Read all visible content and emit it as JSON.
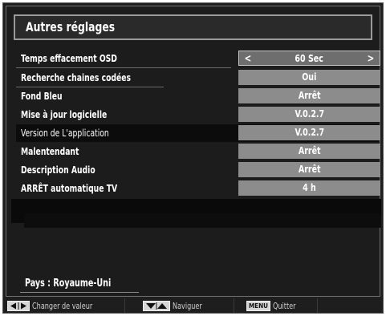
{
  "menu": {
    "title": "Autres réglages",
    "rows": [
      {
        "label": "Temps effacement OSD",
        "value": "60 Sec"
      },
      {
        "label": "Recherche chaines codées",
        "value": "Oui"
      },
      {
        "label": "Fond Bleu",
        "value": "Arrêt"
      },
      {
        "label": "Mise à jour logicielle",
        "value": "V.0.2.7"
      },
      {
        "label": "Version de L'application",
        "value": "V.0.2.7"
      },
      {
        "label": "Malentendant",
        "value": "Arrêt"
      },
      {
        "label": "Description Audio",
        "value": "Arrêt"
      },
      {
        "label": "ARRÊT automatique TV",
        "value": "4 h"
      }
    ],
    "arrow_left": "<",
    "arrow_right": ">"
  },
  "country": "Pays : Royaume-Uni",
  "footer": {
    "change_value": "Changer de valeur",
    "navigate": "Naviguer",
    "menu_key": "MENU",
    "quit": "Quitter"
  }
}
